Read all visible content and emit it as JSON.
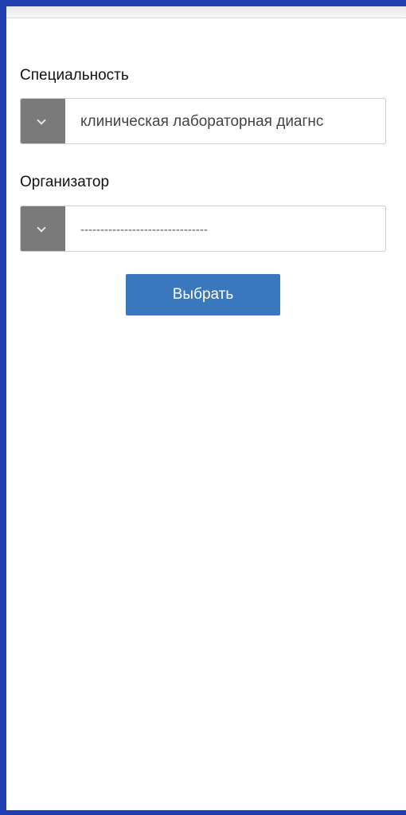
{
  "form": {
    "specialty": {
      "label": "Специальность",
      "value": "клиническая лабораторная диагнс"
    },
    "organizer": {
      "label": "Организатор",
      "value": "--------------------------------"
    },
    "submit_label": "Выбрать"
  },
  "colors": {
    "frame_border": "#1f3fb0",
    "toggle_bg": "#7a7a7a",
    "button_bg": "#3a78bd"
  },
  "icons": {
    "specialty_toggle": "chevron-down-icon",
    "organizer_toggle": "chevron-down-icon"
  }
}
